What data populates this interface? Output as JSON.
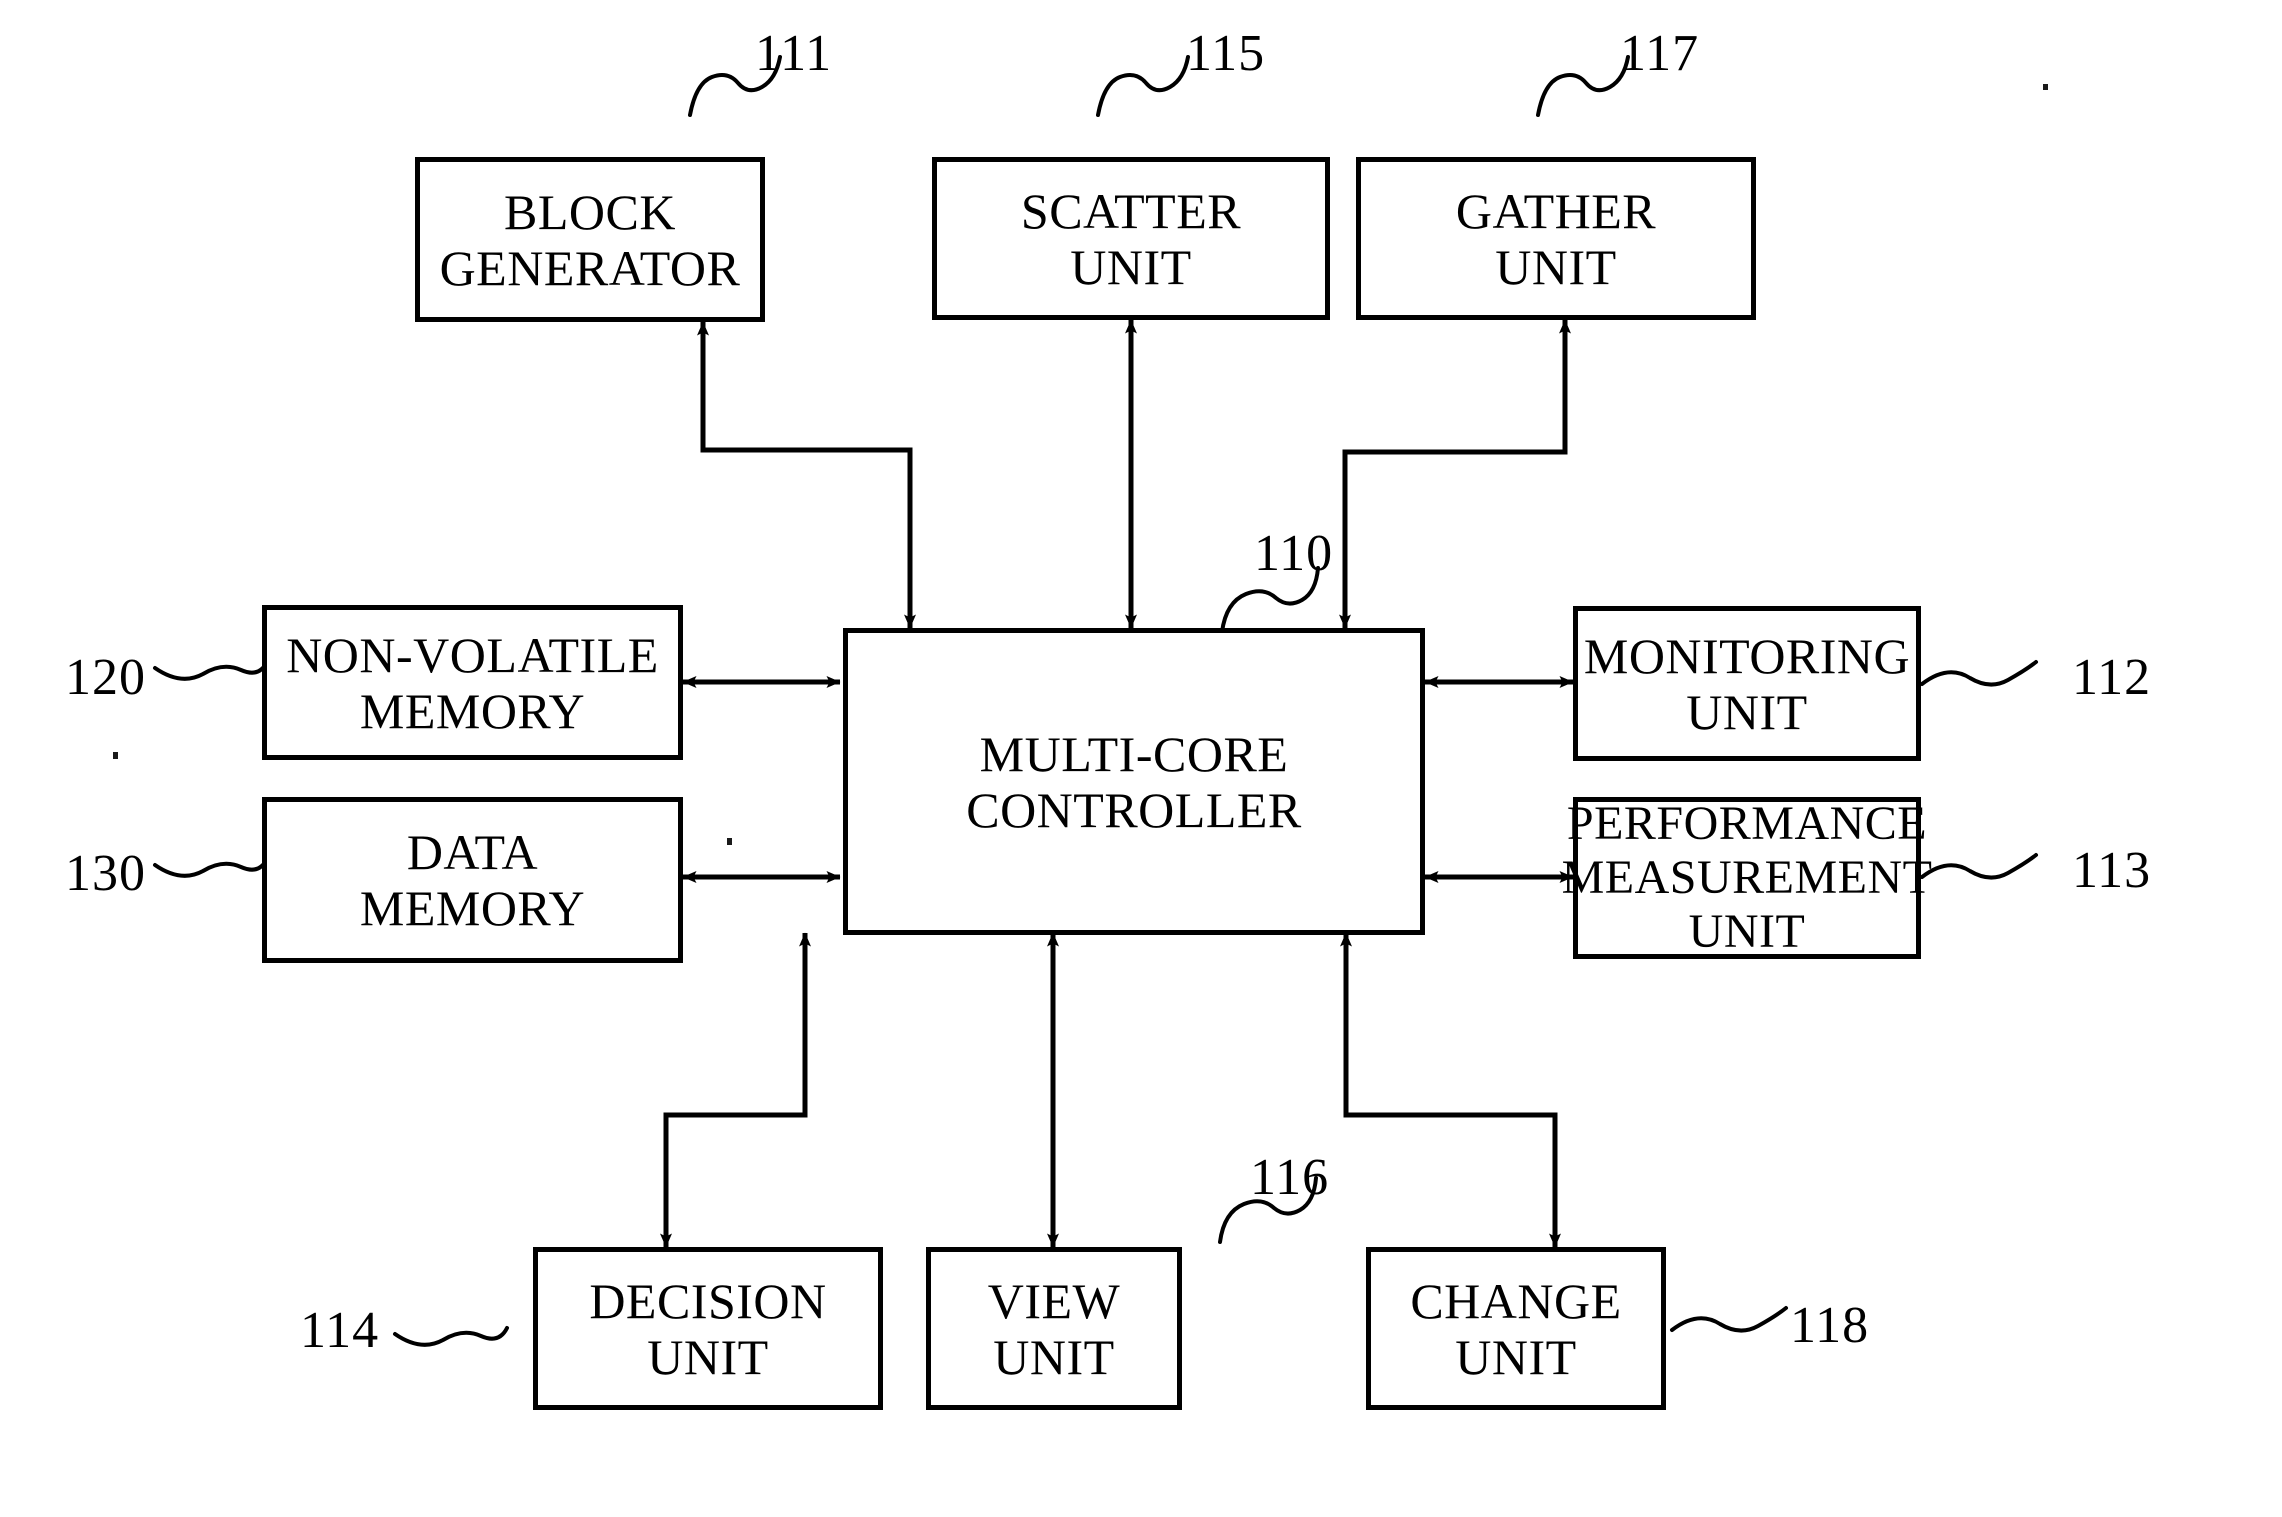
{
  "figure": {
    "title": "Multi-core controller block diagram",
    "line_color": "#000000",
    "background_color": "#ffffff"
  },
  "blocks": {
    "block_generator": {
      "label": "BLOCK\nGENERATOR",
      "ref": "111"
    },
    "scatter_unit": {
      "label": "SCATTER\nUNIT",
      "ref": "115"
    },
    "gather_unit": {
      "label": "GATHER\nUNIT",
      "ref": "117"
    },
    "non_volatile_memory": {
      "label": "NON-VOLATILE\nMEMORY",
      "ref": "120"
    },
    "data_memory": {
      "label": "DATA\nMEMORY",
      "ref": "130"
    },
    "multi_core_controller": {
      "label": "MULTI-CORE\nCONTROLLER",
      "ref": "110"
    },
    "monitoring_unit": {
      "label": "MONITORING\nUNIT",
      "ref": "112"
    },
    "performance_measurement_unit": {
      "label": "PERFORMANCE\nMEASUREMENT\nUNIT",
      "ref": "113"
    },
    "decision_unit": {
      "label": "DECISION\nUNIT",
      "ref": "114"
    },
    "view_unit": {
      "label": "VIEW\nUNIT",
      "ref": "116"
    },
    "change_unit": {
      "label": "CHANGE\nUNIT",
      "ref": "118"
    }
  },
  "connections": [
    {
      "from": "multi_core_controller",
      "to": "block_generator",
      "style": "single-arrow-elbow"
    },
    {
      "from": "multi_core_controller",
      "to": "scatter_unit",
      "style": "double-arrow-vertical"
    },
    {
      "from": "multi_core_controller",
      "to": "gather_unit",
      "style": "double-arrow-elbow"
    },
    {
      "from": "multi_core_controller",
      "to": "non_volatile_memory",
      "style": "double-arrow-horizontal"
    },
    {
      "from": "multi_core_controller",
      "to": "data_memory",
      "style": "double-arrow-horizontal"
    },
    {
      "from": "multi_core_controller",
      "to": "monitoring_unit",
      "style": "double-arrow-horizontal"
    },
    {
      "from": "multi_core_controller",
      "to": "performance_measurement_unit",
      "style": "double-arrow-horizontal"
    },
    {
      "from": "multi_core_controller",
      "to": "decision_unit",
      "style": "double-arrow-elbow"
    },
    {
      "from": "multi_core_controller",
      "to": "view_unit",
      "style": "double-arrow-vertical"
    },
    {
      "from": "multi_core_controller",
      "to": "change_unit",
      "style": "double-arrow-elbow"
    }
  ]
}
